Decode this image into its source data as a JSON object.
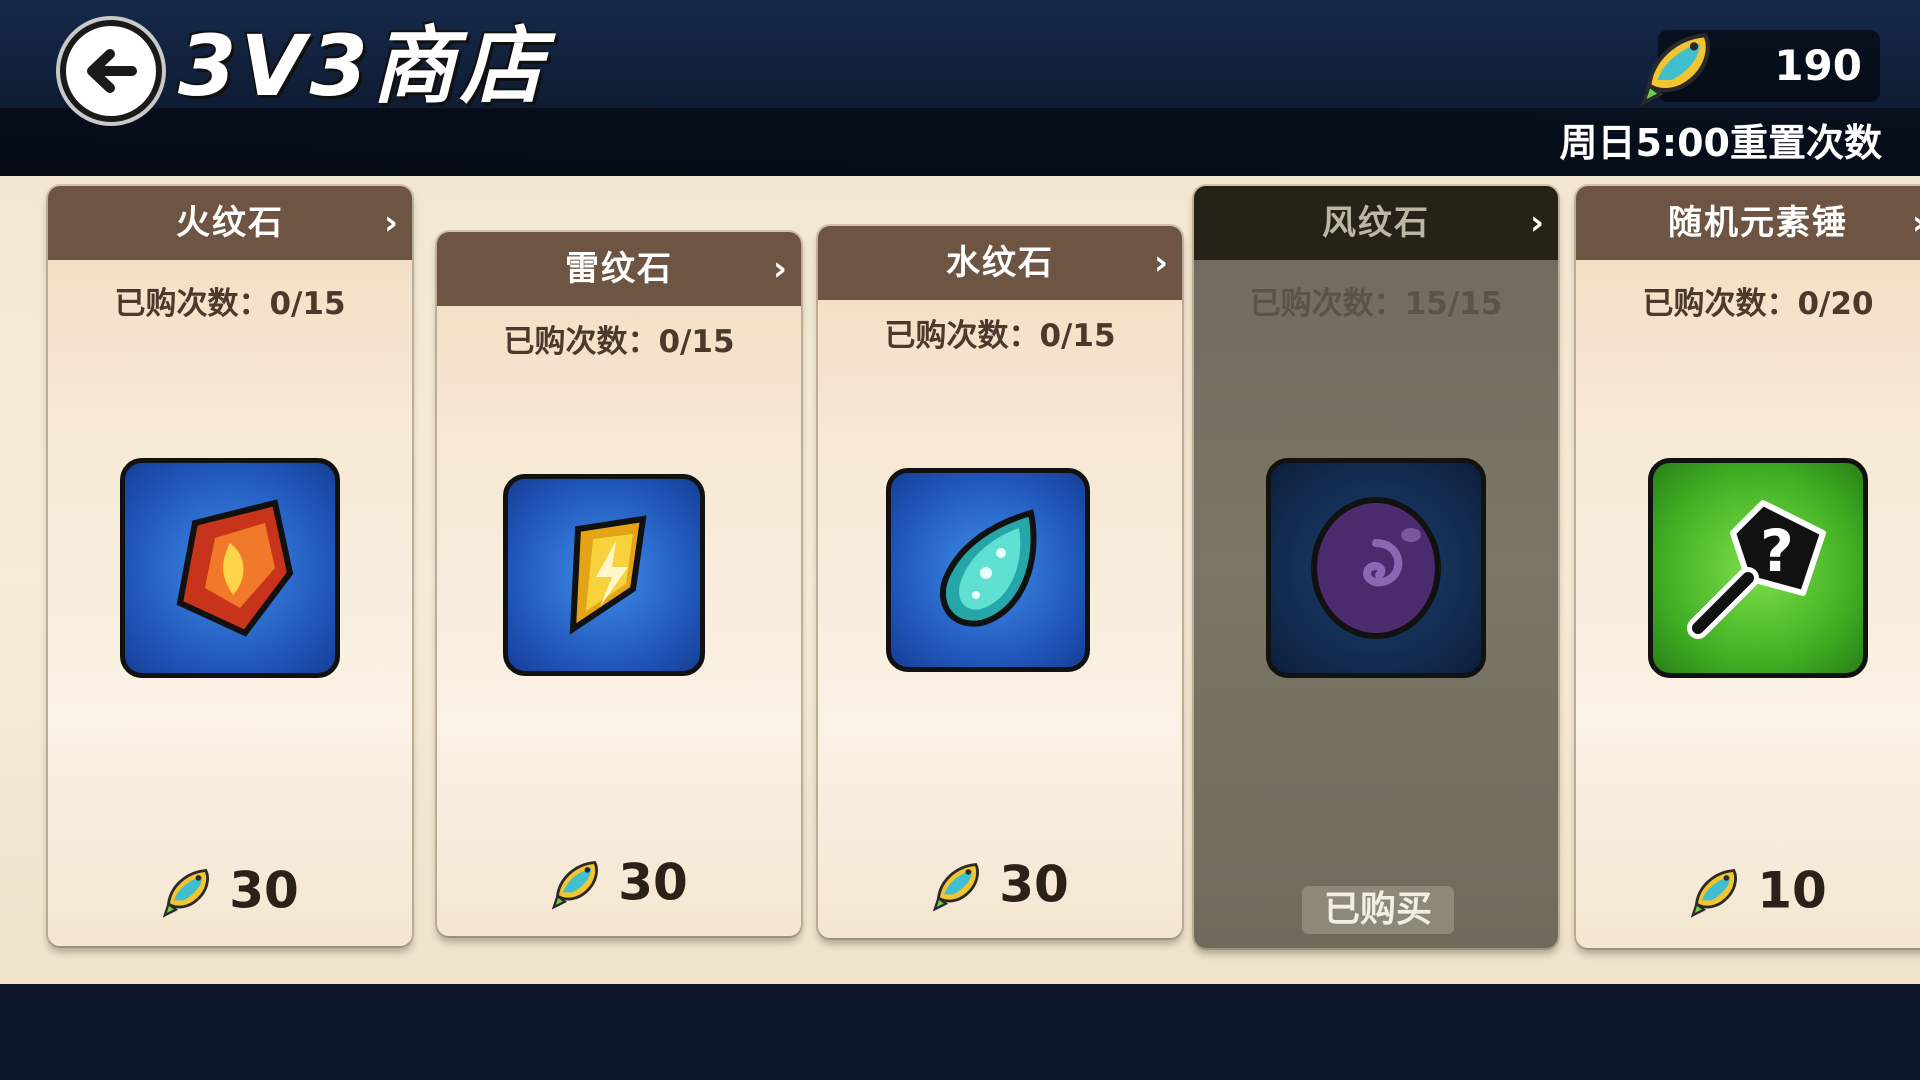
{
  "header": {
    "title": "3V3商店",
    "currency_value": "190",
    "reset_note": "周日5:00重置次数"
  },
  "items": [
    {
      "name": "火纹石",
      "count": "已购次数：0/15",
      "price": "30",
      "icon": "fire-stone-icon"
    },
    {
      "name": "雷纹石",
      "count": "已购次数：0/15",
      "price": "30",
      "icon": "thunder-stone-icon"
    },
    {
      "name": "水纹石",
      "count": "已购次数：0/15",
      "price": "30",
      "icon": "water-stone-icon"
    },
    {
      "name": "风纹石",
      "count": "已购次数：15/15",
      "status": "已购买",
      "icon": "wind-stone-icon"
    },
    {
      "name": "随机元素锤",
      "count": "已购次数：0/20",
      "price": "10",
      "icon": "random-hammer-icon"
    }
  ],
  "colors": {
    "header_bg": "#16294a",
    "card_header": "#6e5443",
    "shop_bg": "#f3e7cf",
    "sold_card": "#7b7565"
  }
}
